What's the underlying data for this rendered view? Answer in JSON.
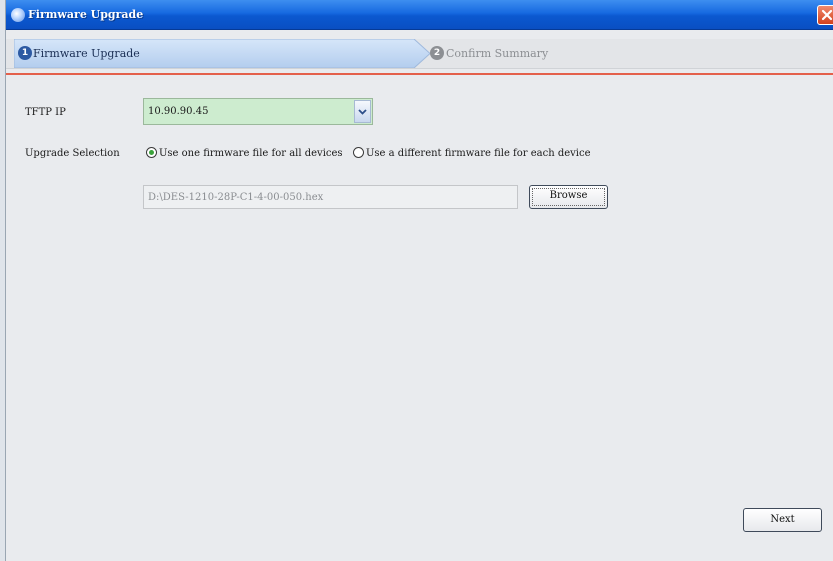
{
  "window": {
    "title": "Firmware Upgrade",
    "accent": "#1669e0",
    "close_color": "#d3411d"
  },
  "steps": [
    {
      "number": "1",
      "label": "Firmware Upgrade",
      "active": true
    },
    {
      "number": "2",
      "label": "Confirm Summary",
      "active": false
    }
  ],
  "form": {
    "tftp_ip_label": "TFTP IP",
    "tftp_ip_value": "10.90.90.45",
    "upgrade_selection_label": "Upgrade Selection",
    "option_one": "Use one firmware file for all devices",
    "option_each": "Use a different firmware file for each device",
    "selected_option": "option_one",
    "file_path": "D:\\DES-1210-28P-C1-4-00-050.hex",
    "browse_label": "Browse"
  },
  "footer": {
    "next_label": "Next"
  },
  "icons": {
    "title": "app-globe-icon",
    "close": "close-icon",
    "dropdown": "chevron-down-icon"
  }
}
